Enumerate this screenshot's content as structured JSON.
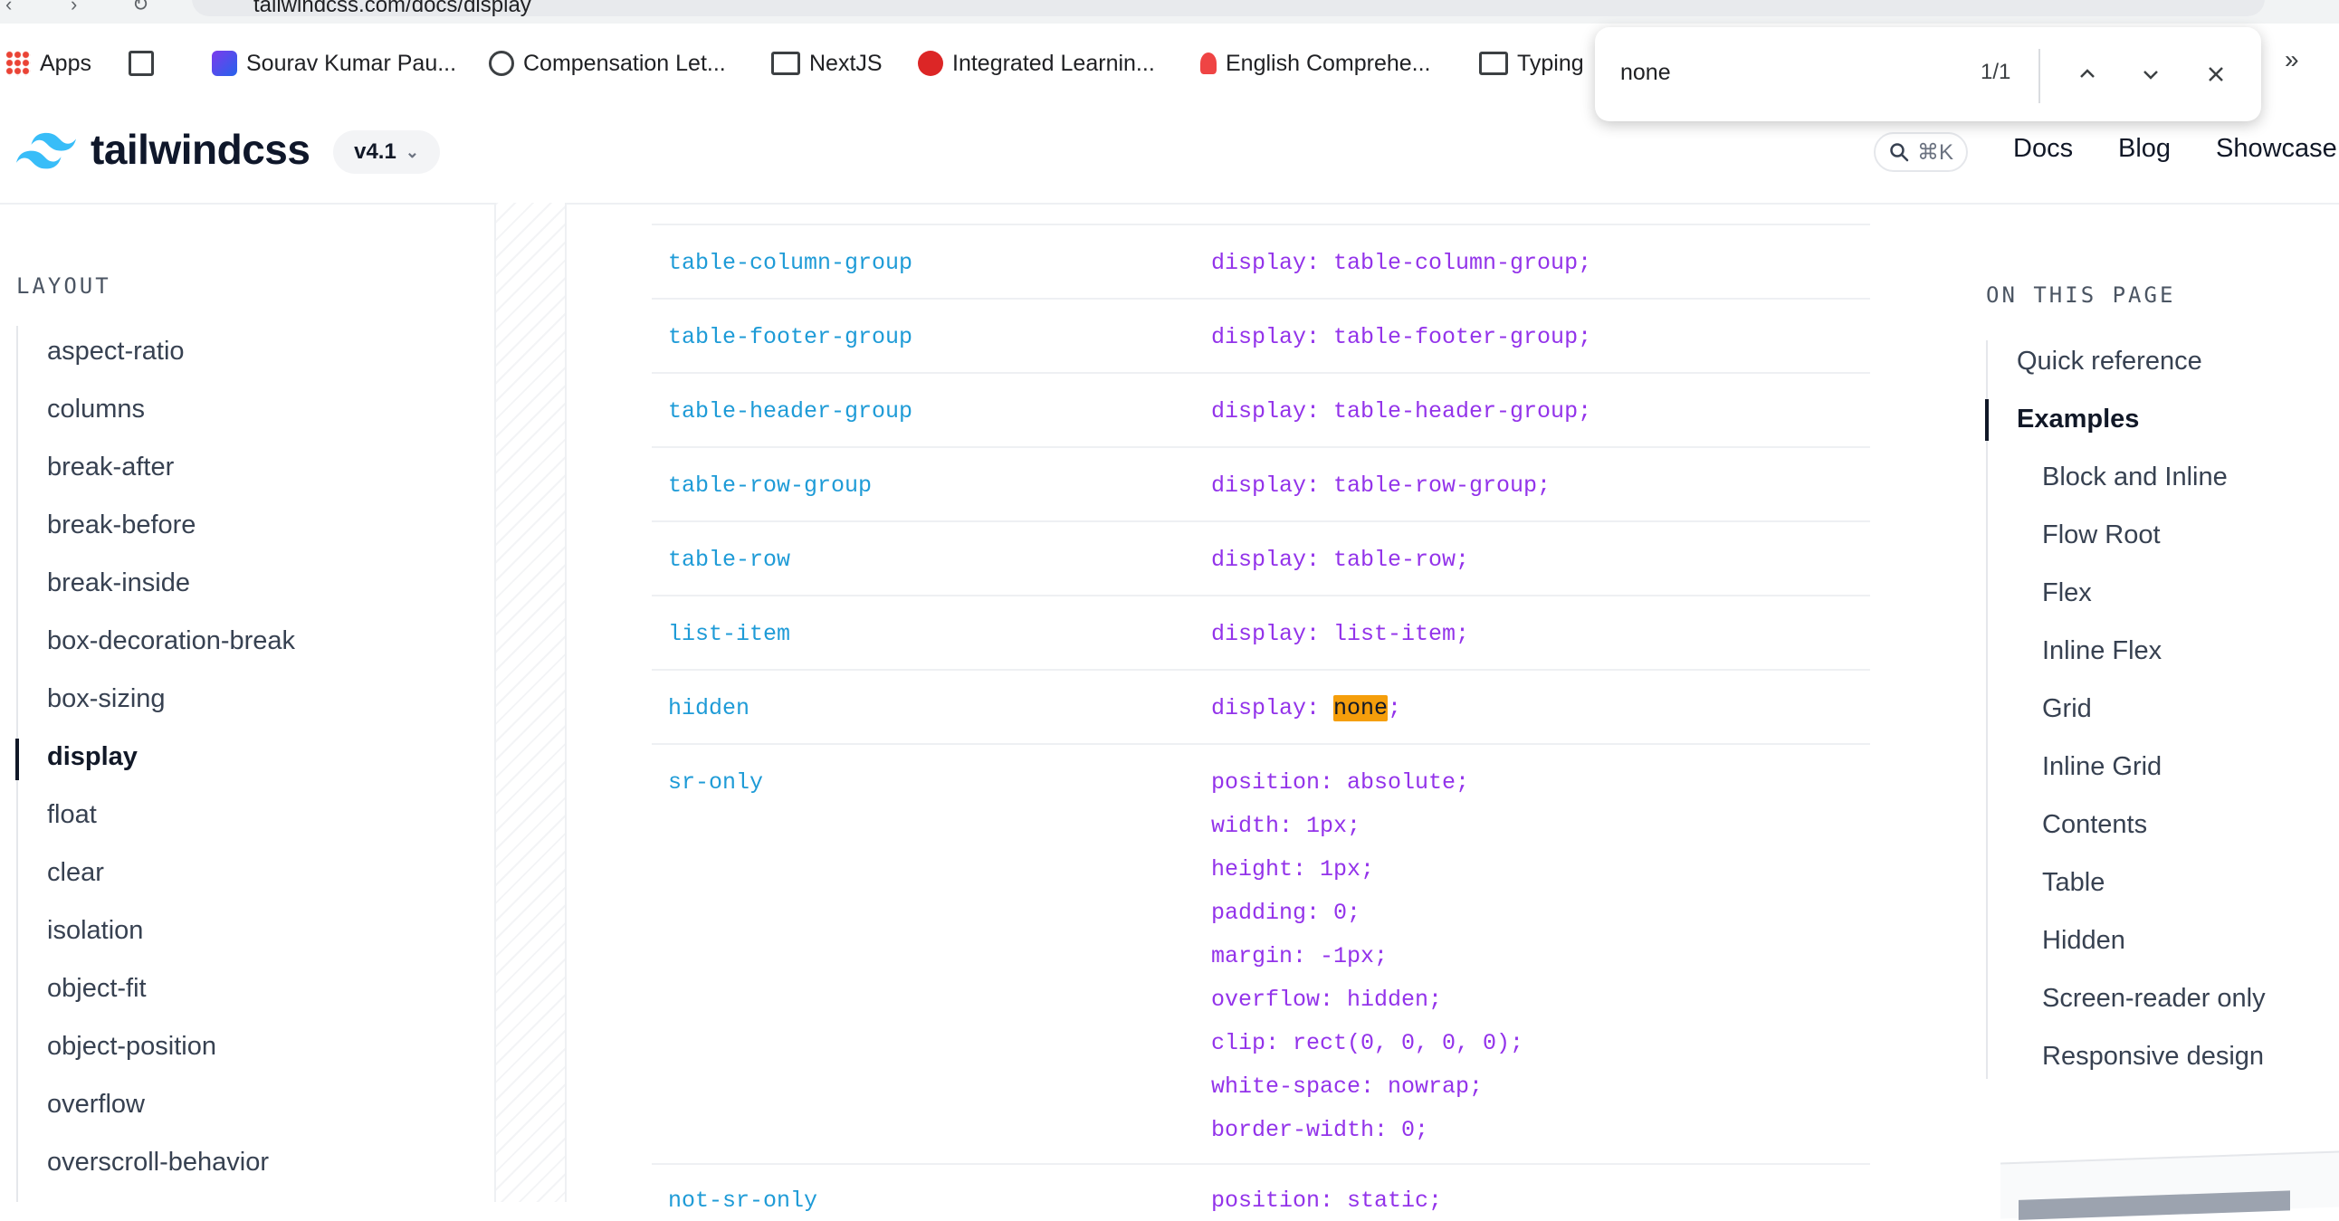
{
  "browser": {
    "url": "tailwindcss.com/docs/display",
    "bookmarks": [
      {
        "label": "Apps",
        "icon": "apps-grid-icon"
      },
      {
        "label": "",
        "icon": "tab-groups-icon"
      },
      {
        "label": "Sourav Kumar Pau...",
        "icon": "profile-icon"
      },
      {
        "label": "Compensation Let...",
        "icon": "globe-icon"
      },
      {
        "label": "NextJS",
        "icon": "folder-icon"
      },
      {
        "label": "Integrated Learnin...",
        "icon": "play-icon"
      },
      {
        "label": "English Comprehe...",
        "icon": "bulb-icon"
      },
      {
        "label": "Typing",
        "icon": "folder-icon"
      }
    ],
    "more_icon": "»"
  },
  "find_bar": {
    "query": "none",
    "count": "1/1"
  },
  "header": {
    "brand": "tailwindcss",
    "version": "v4.1",
    "search_shortcut": "⌘K",
    "nav": [
      "Docs",
      "Blog",
      "Showcase"
    ]
  },
  "sidebar": {
    "section": "LAYOUT",
    "items": [
      "aspect-ratio",
      "columns",
      "break-after",
      "break-before",
      "break-inside",
      "box-decoration-break",
      "box-sizing",
      "display",
      "float",
      "clear",
      "isolation",
      "object-fit",
      "object-position",
      "overflow",
      "overscroll-behavior"
    ],
    "active": "display"
  },
  "table": {
    "rows": [
      {
        "cls": "table-column-group",
        "props": [
          "display: table-column-group;"
        ]
      },
      {
        "cls": "table-footer-group",
        "props": [
          "display: table-footer-group;"
        ]
      },
      {
        "cls": "table-header-group",
        "props": [
          "display: table-header-group;"
        ]
      },
      {
        "cls": "table-row-group",
        "props": [
          "display: table-row-group;"
        ]
      },
      {
        "cls": "table-row",
        "props": [
          "display: table-row;"
        ]
      },
      {
        "cls": "list-item",
        "props": [
          "display: list-item;"
        ]
      },
      {
        "cls": "hidden",
        "props": [
          "display: none;"
        ]
      },
      {
        "cls": "sr-only",
        "props": [
          "position: absolute;",
          "width: 1px;",
          "height: 1px;",
          "padding: 0;",
          "margin: -1px;",
          "overflow: hidden;",
          "clip: rect(0, 0, 0, 0);",
          "white-space: nowrap;",
          "border-width: 0;"
        ]
      },
      {
        "cls": "not-sr-only",
        "props": [
          "position: static;"
        ]
      }
    ],
    "hidden_prefix": "display: ",
    "hidden_match": "none",
    "hidden_suffix": ";"
  },
  "toc": {
    "title": "ON THIS PAGE",
    "items": [
      {
        "label": "Quick reference",
        "level": 1
      },
      {
        "label": "Examples",
        "level": 1
      },
      {
        "label": "Block and Inline",
        "level": 2
      },
      {
        "label": "Flow Root",
        "level": 2
      },
      {
        "label": "Flex",
        "level": 2
      },
      {
        "label": "Inline Flex",
        "level": 2
      },
      {
        "label": "Grid",
        "level": 2
      },
      {
        "label": "Inline Grid",
        "level": 2
      },
      {
        "label": "Contents",
        "level": 2
      },
      {
        "label": "Table",
        "level": 2
      },
      {
        "label": "Hidden",
        "level": 2
      },
      {
        "label": "Screen-reader only",
        "level": 2
      },
      {
        "label": "Responsive design",
        "level": 2
      }
    ],
    "active": "Examples"
  },
  "colors": {
    "class_blue": "#1e9bd7",
    "prop_purple": "#9333ea",
    "highlight": "#f59e0b",
    "logo_cyan": "#38bdf8"
  }
}
